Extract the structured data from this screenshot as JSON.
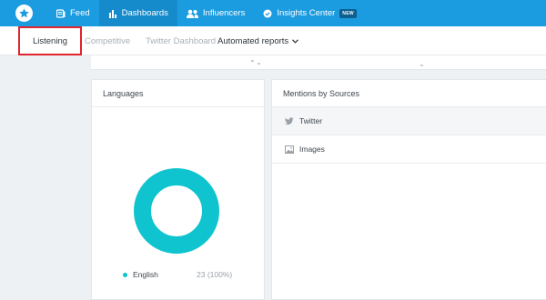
{
  "topnav": {
    "logo_icon": "star-icon",
    "items": [
      {
        "label": "Feed",
        "icon": "feed-icon"
      },
      {
        "label": "Dashboards",
        "icon": "bar-chart-icon"
      },
      {
        "label": "Influencers",
        "icon": "users-icon"
      },
      {
        "label": "Insights Center",
        "icon": "insights-icon",
        "badge": "NEW"
      }
    ],
    "active_item": "Dashboards",
    "colors": {
      "background": "#1b9be0",
      "active": "#168bcc"
    }
  },
  "subnav": {
    "items": [
      {
        "label": "Listening"
      },
      {
        "label": "Competitive"
      },
      {
        "label": "Twitter Dashboard"
      },
      {
        "label": "Automated reports"
      }
    ],
    "highlight_color": "#e0242c"
  },
  "languages": {
    "title": "Languages",
    "legend": [
      {
        "label": "English",
        "value": "23 (100%)",
        "share": 1.0,
        "color": "#0fc4cf"
      }
    ]
  },
  "mentions": {
    "title": "Mentions by Sources",
    "sources": [
      {
        "label": "Twitter",
        "icon": "twitter-icon"
      },
      {
        "label": "Images",
        "icon": "image-icon"
      }
    ]
  }
}
